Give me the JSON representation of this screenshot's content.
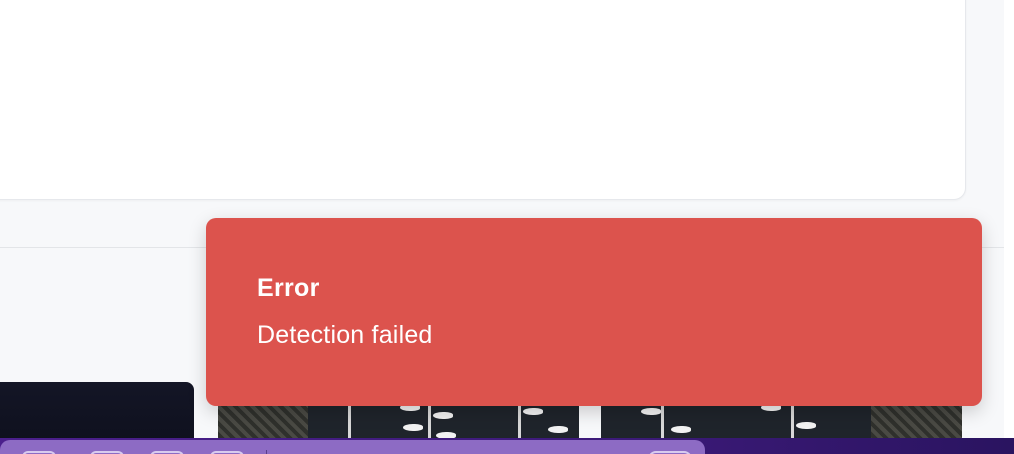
{
  "toast": {
    "title": "Error",
    "message": "Detection failed",
    "color": "#dc534d",
    "type": "error"
  },
  "thumbnails": [
    {
      "name": "dark-thumbnail"
    },
    {
      "name": "satellite-marina-thumbnail"
    },
    {
      "name": "satellite-marina-thumbnail"
    }
  ],
  "colors": {
    "background": "#f7f8fa",
    "card": "#ffffff",
    "dock": "#8d6bc4",
    "desktop": "#4b1f8c"
  }
}
